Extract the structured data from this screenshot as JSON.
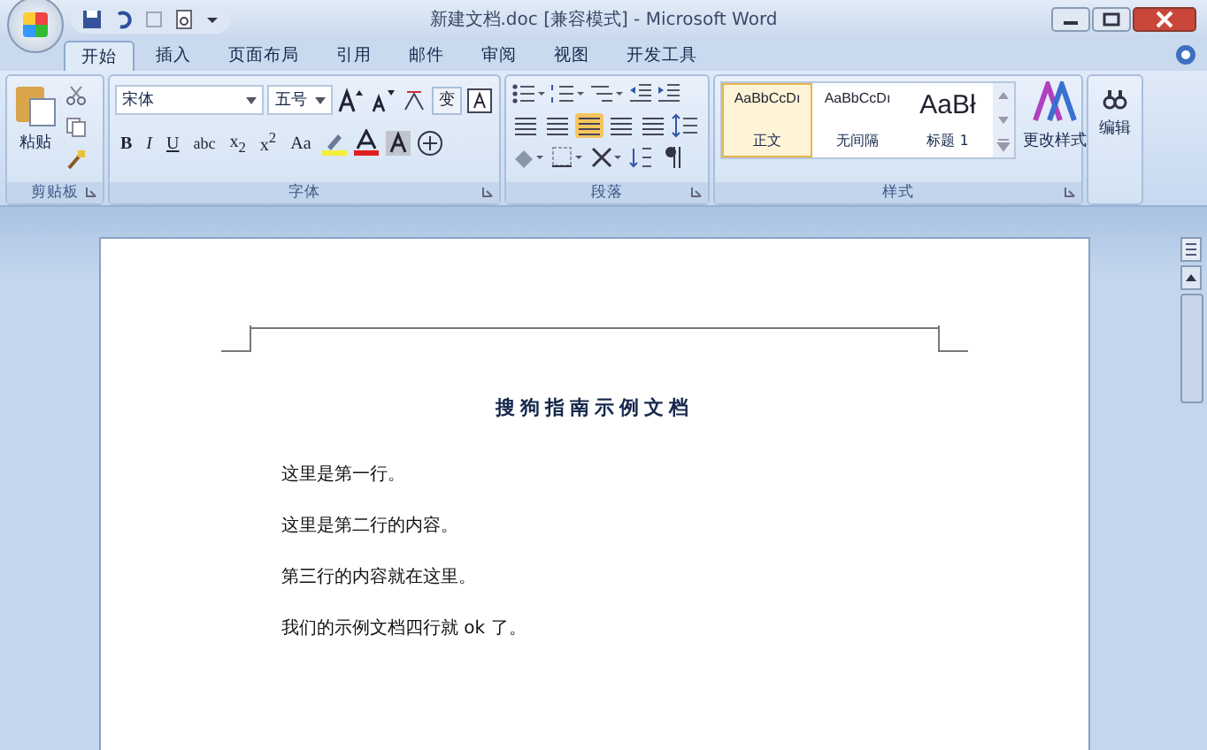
{
  "window": {
    "title": "新建文档.doc [兼容模式] - Microsoft Word"
  },
  "tabs": [
    {
      "label": "开始",
      "selected": true
    },
    {
      "label": "插入",
      "selected": false
    },
    {
      "label": "页面布局",
      "selected": false
    },
    {
      "label": "引用",
      "selected": false
    },
    {
      "label": "邮件",
      "selected": false
    },
    {
      "label": "审阅",
      "selected": false
    },
    {
      "label": "视图",
      "selected": false
    },
    {
      "label": "开发工具",
      "selected": false
    }
  ],
  "clipboard": {
    "label": "剪贴板",
    "paste": "粘贴"
  },
  "font": {
    "label": "字体",
    "font_name": "宋体",
    "font_size": "五号",
    "change_case": "变",
    "format_buttons": [
      "B",
      "I",
      "U",
      "abc",
      "x$_{2}$",
      "x$^{2}$",
      "Aa"
    ]
  },
  "paragraph": {
    "label": "段落",
    "align_buttons": [
      {
        "selected": false
      },
      {
        "selected": false
      },
      {
        "selected": true
      },
      {
        "selected": false
      },
      {
        "selected": false
      }
    ]
  },
  "styles": {
    "label": "样式",
    "gallery": [
      {
        "sample": "AaBbCcDı",
        "name": "正文",
        "selected": true
      },
      {
        "sample": "AaBbCcDı",
        "name": "无间隔",
        "selected": false
      },
      {
        "sample": "AaBł",
        "name": "标题 1",
        "selected": false
      }
    ],
    "change_styles": "更改样式"
  },
  "editing": {
    "label": "编辑"
  },
  "document": {
    "title": "搜狗指南示例文档",
    "paragraphs": [
      "这里是第一行。",
      "这里是第二行的内容。",
      "第三行的内容就在这里。",
      "我们的示例文档四行就 ok 了。"
    ]
  }
}
